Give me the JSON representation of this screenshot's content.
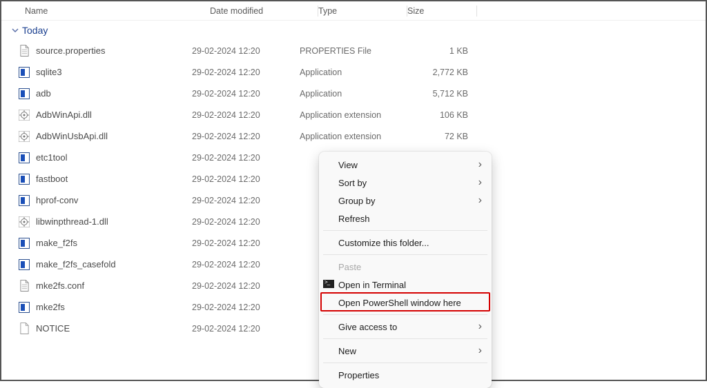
{
  "columns": {
    "name": "Name",
    "date": "Date modified",
    "type": "Type",
    "size": "Size"
  },
  "group": {
    "label": "Today"
  },
  "files": [
    {
      "name": "source.properties",
      "date": "29-02-2024 12:20",
      "type": "PROPERTIES File",
      "size": "1 KB",
      "icon": "doc"
    },
    {
      "name": "sqlite3",
      "date": "29-02-2024 12:20",
      "type": "Application",
      "size": "2,772 KB",
      "icon": "app"
    },
    {
      "name": "adb",
      "date": "29-02-2024 12:20",
      "type": "Application",
      "size": "5,712 KB",
      "icon": "app"
    },
    {
      "name": "AdbWinApi.dll",
      "date": "29-02-2024 12:20",
      "type": "Application extension",
      "size": "106 KB",
      "icon": "dll"
    },
    {
      "name": "AdbWinUsbApi.dll",
      "date": "29-02-2024 12:20",
      "type": "Application extension",
      "size": "72 KB",
      "icon": "dll"
    },
    {
      "name": "etc1tool",
      "date": "29-02-2024 12:20",
      "type": "",
      "size": "",
      "icon": "app"
    },
    {
      "name": "fastboot",
      "date": "29-02-2024 12:20",
      "type": "",
      "size": "",
      "icon": "app"
    },
    {
      "name": "hprof-conv",
      "date": "29-02-2024 12:20",
      "type": "",
      "size": "",
      "icon": "app"
    },
    {
      "name": "libwinpthread-1.dll",
      "date": "29-02-2024 12:20",
      "type": "",
      "size": "",
      "icon": "dll"
    },
    {
      "name": "make_f2fs",
      "date": "29-02-2024 12:20",
      "type": "",
      "size": "",
      "icon": "app"
    },
    {
      "name": "make_f2fs_casefold",
      "date": "29-02-2024 12:20",
      "type": "",
      "size": "",
      "icon": "app"
    },
    {
      "name": "mke2fs.conf",
      "date": "29-02-2024 12:20",
      "type": "",
      "size": "",
      "icon": "doc"
    },
    {
      "name": "mke2fs",
      "date": "29-02-2024 12:20",
      "type": "",
      "size": "",
      "icon": "app"
    },
    {
      "name": "NOTICE",
      "date": "29-02-2024 12:20",
      "type": "",
      "size": "",
      "icon": "unknown"
    }
  ],
  "context_menu": {
    "items": [
      {
        "label": "View",
        "arrow": true,
        "enabled": true
      },
      {
        "label": "Sort by",
        "arrow": true,
        "enabled": true
      },
      {
        "label": "Group by",
        "arrow": true,
        "enabled": true
      },
      {
        "label": "Refresh",
        "arrow": false,
        "enabled": true
      },
      {
        "sep": true
      },
      {
        "label": "Customize this folder...",
        "arrow": false,
        "enabled": true
      },
      {
        "sep": true
      },
      {
        "label": "Paste",
        "arrow": false,
        "enabled": false
      },
      {
        "label": "Open in Terminal",
        "arrow": false,
        "enabled": true,
        "preicon": "terminal"
      },
      {
        "label": "Open PowerShell window here",
        "arrow": false,
        "enabled": true,
        "highlight": true
      },
      {
        "sep": true
      },
      {
        "label": "Give access to",
        "arrow": true,
        "enabled": true
      },
      {
        "sep": true
      },
      {
        "label": "New",
        "arrow": true,
        "enabled": true
      },
      {
        "sep": true
      },
      {
        "label": "Properties",
        "arrow": false,
        "enabled": true
      }
    ]
  }
}
